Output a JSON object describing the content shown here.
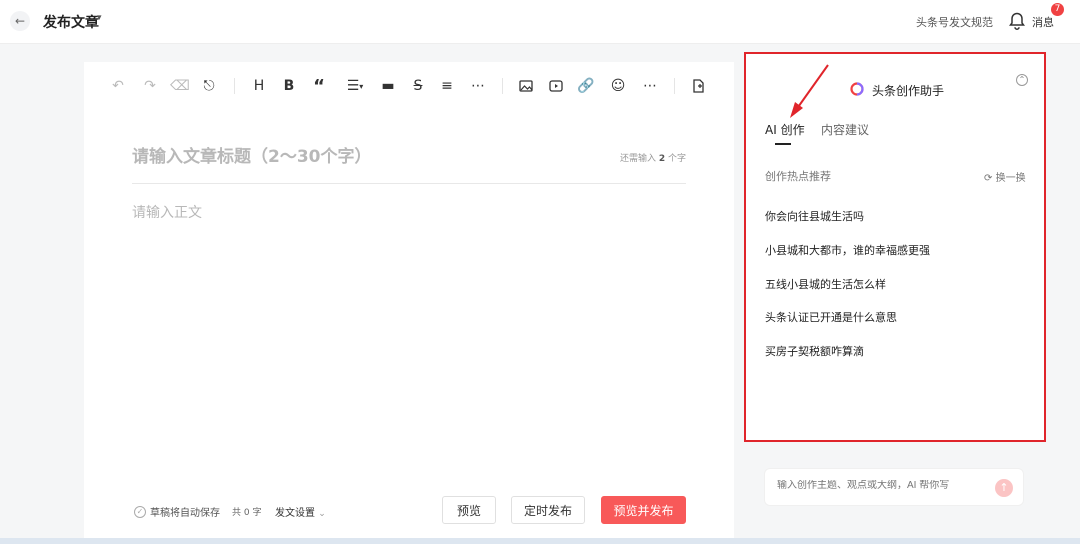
{
  "header": {
    "back_icon": "arrow-left-icon",
    "title": "发布文章",
    "guide_link": "头条号发文规范",
    "messages_label": "消息",
    "messages_badge": "7"
  },
  "toolbar": {
    "icons": [
      "undo-icon",
      "redo-icon",
      "eraser-icon",
      "format-painter-icon",
      "heading-icon",
      "bold-icon",
      "quote-icon",
      "list-icon",
      "divider-icon",
      "strikethrough-icon",
      "align-icon",
      "more-icon",
      "image-icon",
      "video-icon",
      "link-icon",
      "emoji-icon",
      "more-icon",
      "insert-doc-icon"
    ]
  },
  "editor": {
    "title_placeholder": "请输入文章标题（2～30个字）",
    "title_counter_prefix": "还需输入",
    "title_counter_value": "2",
    "title_counter_suffix": "个字",
    "body_placeholder": "请输入正文"
  },
  "footer": {
    "autosave": "草稿将自动保存",
    "word_count": "共 0 字",
    "publish_settings": "发文设置",
    "preview_button": "预览",
    "schedule_button": "定时发布",
    "preview_publish_button": "预览并发布"
  },
  "assistant": {
    "title": "头条创作助手",
    "tabs": [
      "AI 创作",
      "内容建议"
    ],
    "active_tab": 0,
    "section_title": "创作热点推荐",
    "refresh_label": "换一换",
    "suggestions": [
      "你会向往县城生活吗",
      "小县城和大都市，谁的幸福感更强",
      "五线小县城的生活怎么样",
      "头条认证已开通是什么意思",
      "买房子契税额咋算滴"
    ],
    "input_placeholder": "输入创作主题、观点或大纲，AI 帮你写"
  },
  "colors": {
    "accent": "#f85959",
    "highlight_border": "#e0252b",
    "badge": "#f04142"
  }
}
